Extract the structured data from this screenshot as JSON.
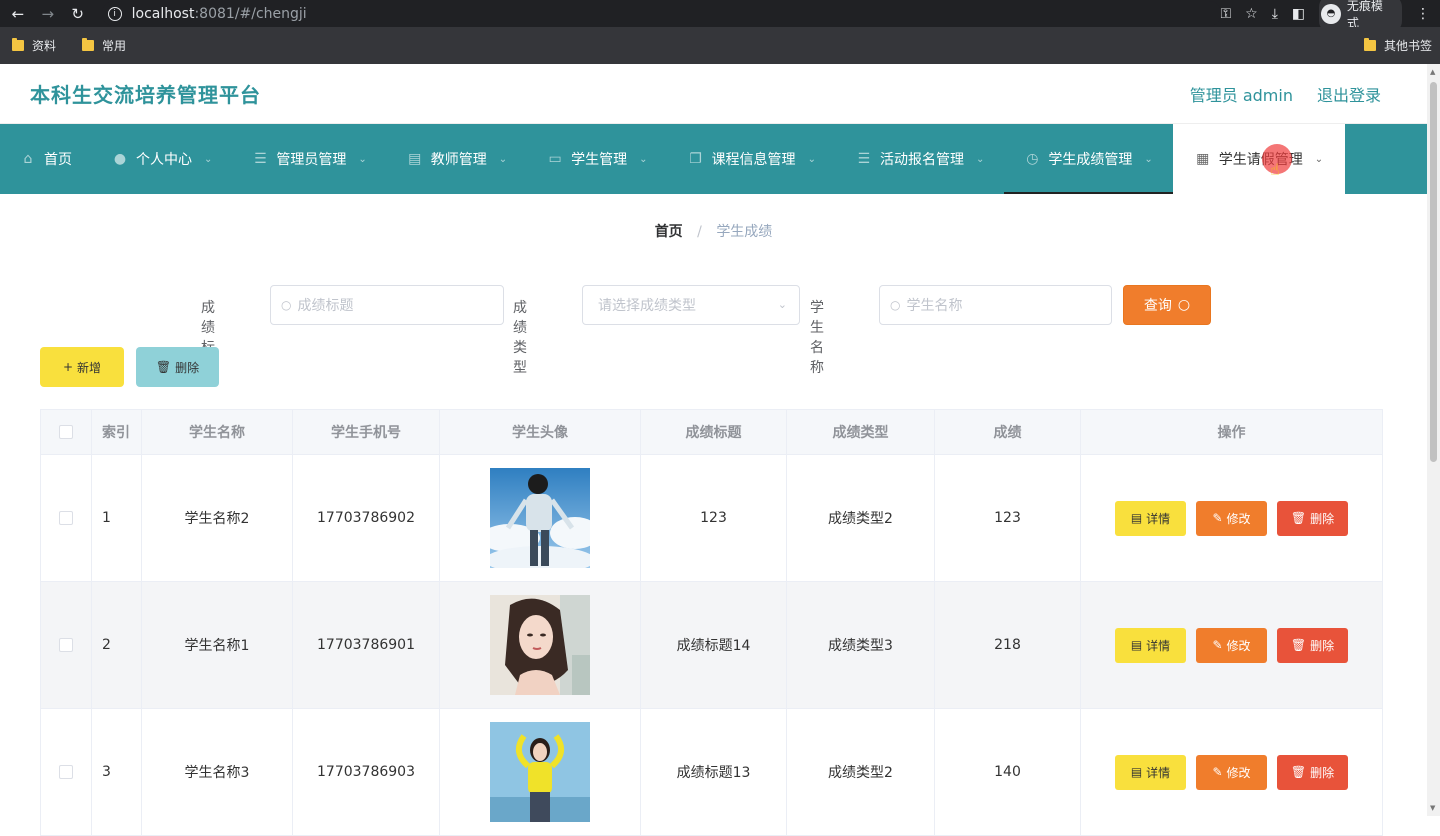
{
  "browser": {
    "url_host": "localhost",
    "url_path": ":8081/#/chengji",
    "incognito_label": "无痕模式",
    "bookmarks": [
      "资料",
      "常用"
    ],
    "other_bookmarks": "其他书签"
  },
  "header": {
    "title": "本科生交流培养管理平台",
    "user": "管理员 admin",
    "logout": "退出登录"
  },
  "menu": [
    {
      "label": "首页",
      "icon": "home-icon"
    },
    {
      "label": "个人中心",
      "icon": "user-icon"
    },
    {
      "label": "管理员管理",
      "icon": "list-icon"
    },
    {
      "label": "教师管理",
      "icon": "clipboard-icon"
    },
    {
      "label": "学生管理",
      "icon": "image-icon"
    },
    {
      "label": "课程信息管理",
      "icon": "copy-icon"
    },
    {
      "label": "活动报名管理",
      "icon": "list-icon"
    },
    {
      "label": "学生成绩管理",
      "icon": "clock-icon"
    },
    {
      "label": "学生请假管理",
      "icon": "grid-icon"
    }
  ],
  "breadcrumb": {
    "home": "首页",
    "current": "学生成绩"
  },
  "search": {
    "title_label": "成绩标题",
    "title_placeholder": "成绩标题",
    "type_label": "成绩类型",
    "type_placeholder": "请选择成绩类型",
    "name_label": "学生名称",
    "name_placeholder": "学生名称",
    "query_label": "查询"
  },
  "actions": {
    "add": "新增",
    "delete": "删除"
  },
  "table": {
    "headers": [
      "索引",
      "学生名称",
      "学生手机号",
      "学生头像",
      "成绩标题",
      "成绩类型",
      "成绩",
      "操作"
    ],
    "rows": [
      {
        "index": "1",
        "name": "学生名称2",
        "phone": "17703786902",
        "title": "123",
        "type": "成绩类型2",
        "score": "123"
      },
      {
        "index": "2",
        "name": "学生名称1",
        "phone": "17703786901",
        "title": "成绩标题14",
        "type": "成绩类型3",
        "score": "218"
      },
      {
        "index": "3",
        "name": "学生名称3",
        "phone": "17703786903",
        "title": "成绩标题13",
        "type": "成绩类型2",
        "score": "140"
      }
    ],
    "row_actions": {
      "detail": "详情",
      "edit": "修改",
      "delete": "删除"
    }
  },
  "colors": {
    "primary": "#2f939b",
    "query": "#f07d2c",
    "add": "#f9e03d",
    "danger": "#e8533a"
  }
}
